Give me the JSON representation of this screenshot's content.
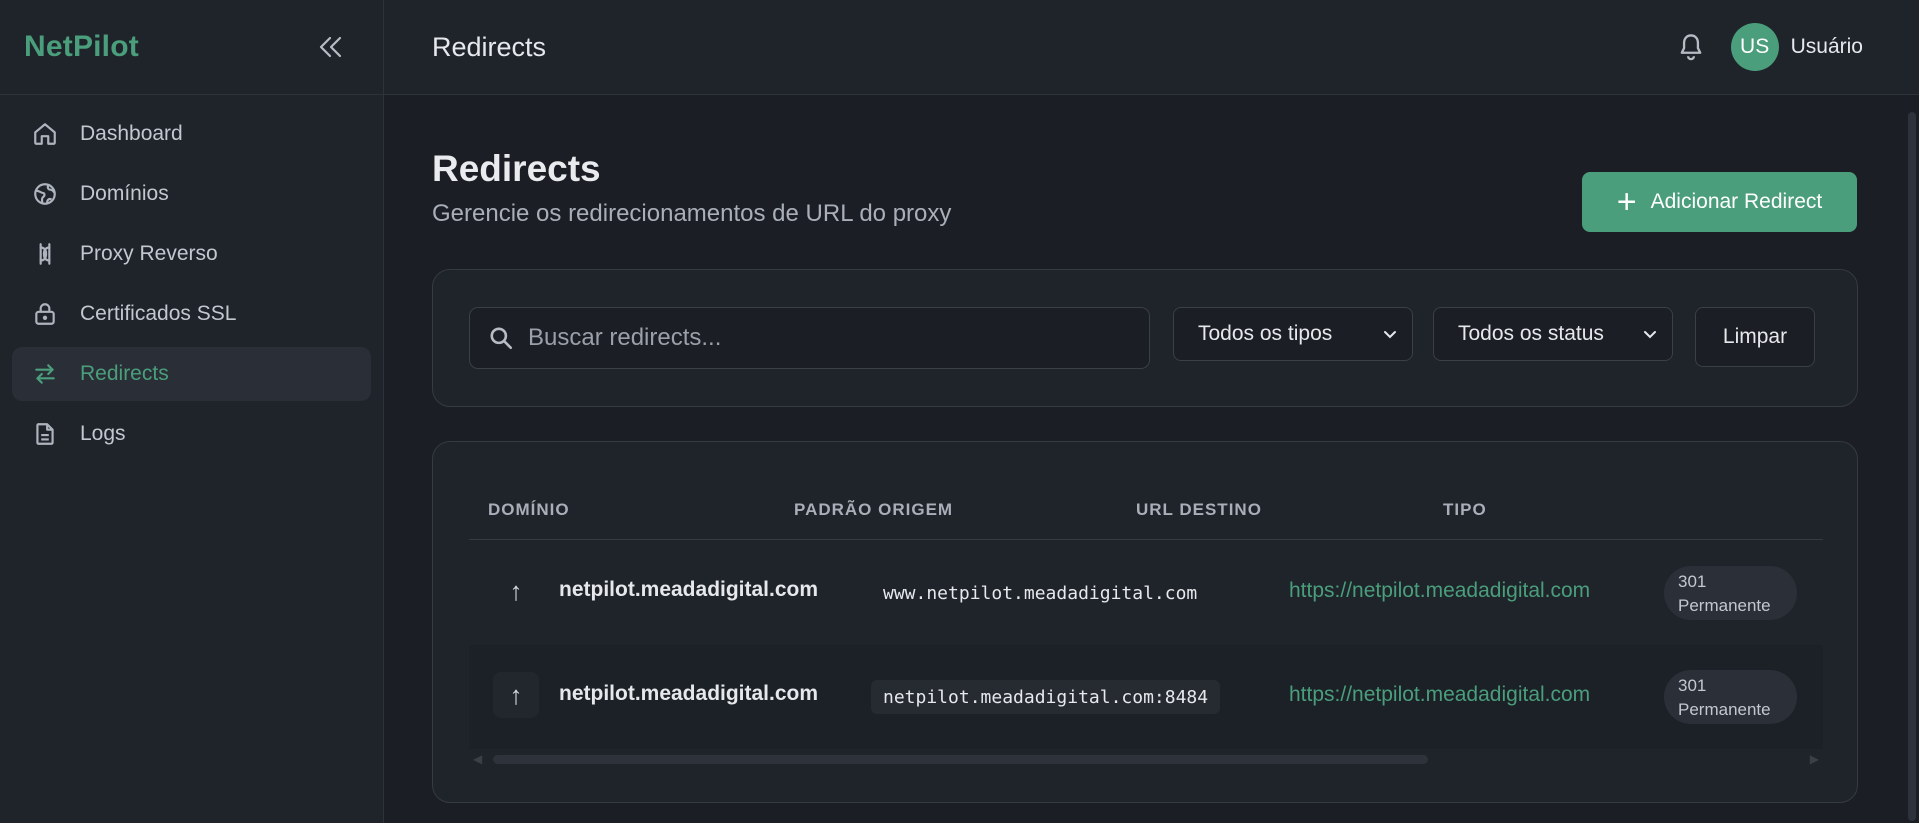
{
  "app": {
    "brand": "NetPilot"
  },
  "sidebar": {
    "items": [
      {
        "label": "Dashboard",
        "icon": "home-icon",
        "active": false
      },
      {
        "label": "Domínios",
        "icon": "globe-icon",
        "active": false
      },
      {
        "label": "Proxy Reverso",
        "icon": "proxy-icon",
        "active": false
      },
      {
        "label": "Certificados SSL",
        "icon": "lock-icon",
        "active": false
      },
      {
        "label": "Redirects",
        "icon": "arrows-swap-icon",
        "active": true
      },
      {
        "label": "Logs",
        "icon": "document-icon",
        "active": false
      }
    ]
  },
  "header": {
    "title": "Redirects",
    "avatar_initials": "US",
    "username": "Usuário"
  },
  "page": {
    "title": "Redirects",
    "subtitle": "Gerencie os redirecionamentos de URL do proxy",
    "add_button": "Adicionar Redirect"
  },
  "filters": {
    "search_placeholder": "Buscar redirects...",
    "type_select": "Todos os tipos",
    "status_select": "Todos os status",
    "clear_button": "Limpar"
  },
  "table": {
    "headers": [
      "DOMÍNIO",
      "PADRÃO ORIGEM",
      "URL DESTINO",
      "TIPO"
    ],
    "rows": [
      {
        "domain": "netpilot.meadadigital.com",
        "origin": "www.netpilot.meadadigital.com",
        "destination": "https://netpilot.meadadigital.com",
        "type_code": "301",
        "type_label": "Permanente"
      },
      {
        "domain": "netpilot.meadadigital.com",
        "origin": "netpilot.meadadigital.com:8484",
        "destination": "https://netpilot.meadadigital.com",
        "type_code": "301",
        "type_label": "Permanente"
      }
    ]
  },
  "colors": {
    "accent": "#4a9e7b",
    "background": "#1b1e24",
    "panel": "#1f232a"
  }
}
